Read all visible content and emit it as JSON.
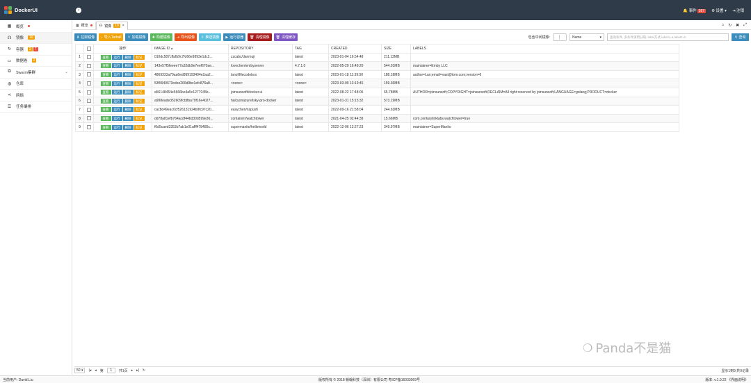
{
  "app": {
    "title": "DockerUI"
  },
  "header": {
    "events_label": "事件",
    "events_count": "267",
    "settings_label": "设置",
    "logout_label": "注销"
  },
  "sidebar": {
    "items": [
      {
        "label": "概览"
      },
      {
        "label": "镜像",
        "badge": "10"
      },
      {
        "label": "容器",
        "badge1": "2",
        "badge2": "7"
      },
      {
        "label": "数据卷",
        "badge": "2"
      },
      {
        "label": "Swarm集群"
      },
      {
        "label": "仓库"
      },
      {
        "label": "网络"
      },
      {
        "label": "任务编排"
      }
    ]
  },
  "tabs": [
    {
      "label": "概览"
    },
    {
      "label": "镜像",
      "badge": "10"
    }
  ],
  "toolbar": {
    "buttons": [
      "拉取镜像",
      "导入Tarball",
      "加载镜像",
      "构建镜像",
      "导出镜像",
      "推送镜像",
      "运行容器",
      "清理镜像",
      "清理缓存"
    ],
    "colors": [
      "#3c8dbc",
      "#f0a30a",
      "#3c8dbc",
      "#5cb85c",
      "#e8531a",
      "#5bc0de",
      "#3c8dbc",
      "#a51d1d",
      "#7e57c2"
    ],
    "include_intermediate_label": "包含中间镜像:",
    "sort_value": "Name",
    "search_placeholder": "查询条件, 多条件请用分隔, label方式 label1=a,label2=b",
    "query_label": "查询"
  },
  "table": {
    "columns": [
      "",
      "",
      "操作",
      "IMAGE ID",
      "REPOSITORY",
      "TAG",
      "CREATED",
      "SIZE",
      "LABELS"
    ],
    "actions": [
      "查看",
      "运行",
      "删除",
      "标记"
    ],
    "rows": [
      {
        "n": "1",
        "id": "010dc587cffafb9c7fd66e9893e1dc2...",
        "repo": "zzcabc/danmuji",
        "tag": "latest",
        "created": "2023-01-04 16:54:48",
        "size": "211.12MB",
        "labels": ""
      },
      {
        "n": "2",
        "id": "143e57f5feeee77a32db9e7eef670ae...",
        "repo": "lovechen/embyserver",
        "tag": "4.7.1.0",
        "created": "2022-05-29 16:49:20",
        "size": "544.01MB",
        "labels": "maintainer=Emby LLC"
      },
      {
        "n": "3",
        "id": "4869333a79aa6ed899193494e2aa2...",
        "repo": "lanol/filecodebox",
        "tag": "latest",
        "created": "2023-01-18 11:39:50",
        "size": "188.18MB",
        "labels": "author=Lan;email=vast@tom.com;version=6"
      },
      {
        "n": "4",
        "id": "53f5940673cdee266d9bc1efc876a8...",
        "repo": "<none>",
        "tag": "<none>",
        "created": "2023-03-09 13:19:46",
        "size": "159.36MB",
        "labels": ""
      },
      {
        "n": "5",
        "id": "a56148454e5666be4a5c1277045b...",
        "repo": "joinsunsoft/docker.ui",
        "tag": "latest",
        "created": "2022-08-22 17:48:06",
        "size": "65.78MB",
        "labels": "AUTHOR=joinsunsoft;COPYRIGHT=joinsunsoft;DECLAIM=All right reserved by joinsunsoft;LANGUAGE=golang;PRODUCT=docker"
      },
      {
        "n": "6",
        "id": "a998eade352609fcb8ba79f16e4027...",
        "repo": "halcyonazure/lsky-pro-docker",
        "tag": "latest",
        "created": "2023-01-31 15:15:32",
        "size": "573.19MB",
        "labels": ""
      },
      {
        "n": "7",
        "id": "cac8d49eac0cf526131924b9fc97c20...",
        "repo": "easychen/nspush",
        "tag": "latest",
        "created": "2022-09-16 21:58:04",
        "size": "244.63MB",
        "labels": ""
      },
      {
        "n": "8",
        "id": "dd78a81efb764acdf44bd30d599e36...",
        "repo": "containrrr/watchtower",
        "tag": "latest",
        "created": "2021-04-25 02:44:39",
        "size": "15.66MB",
        "labels": "com.centurylinklabs.watchtower=true"
      },
      {
        "n": "9",
        "id": "f0d5caed3353b7ab1e01afff478485c...",
        "repo": "supermanito/helloworld",
        "tag": "latest",
        "created": "2022-12-06 12:27:23",
        "size": "349.97MB",
        "labels": "maintainer=SuperManito"
      }
    ]
  },
  "pager": {
    "page_size": "50",
    "page_prefix": "第",
    "page_value": "1",
    "page_suffix": "共1页",
    "summary": "显示1到9,共9记录"
  },
  "footer": {
    "user": "当前用户: David.Liu",
    "copyright": "版权所有 © 2018 赣翰科技（深圳）有限公司 粤ICP备16033069号",
    "version": "版本: v.1.0.22 《界面说明》"
  },
  "watermark": {
    "text": "Panda不是猫"
  }
}
